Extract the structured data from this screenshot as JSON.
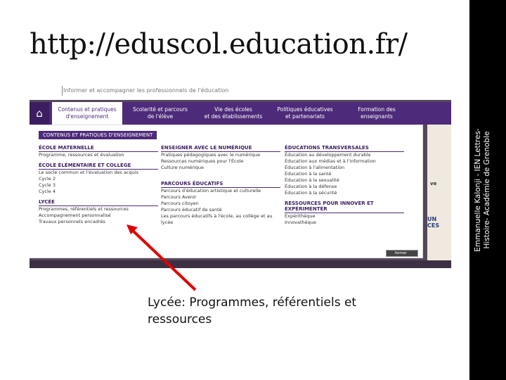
{
  "slide": {
    "title": "http://eduscol.education.fr/",
    "side_note_line1": "Emmanuelle Kalonji - IEN Lettres-",
    "side_note_line2": "Histoire- Académie de Grenoble",
    "caption_line1": "Lycée: Programmes, référentiels et",
    "caption_line2": "ressources"
  },
  "screenshot": {
    "top_text": "Informer et accompagner les professionnels de l'éducation",
    "nav": [
      {
        "label1": "Contenus et pratiques",
        "label2": "d'enseignement"
      },
      {
        "label1": "Scolarité et parcours",
        "label2": "de l'élève"
      },
      {
        "label1": "Vie des écoles",
        "label2": "et des établissements"
      },
      {
        "label1": "Politiques éducatives",
        "label2": "et partenariats"
      },
      {
        "label1": "Formation des",
        "label2": "enseignants"
      }
    ],
    "menu_head": "CONTENUS ET PRATIQUES D'ENSEIGNEMENT",
    "col1": {
      "sec1": "ÉCOLE MATERNELLE",
      "links1": [
        "Programme, ressources et évaluation"
      ],
      "sec2": "ÉCOLE ÉLÉMENTAIRE ET COLLÈGE",
      "links2": [
        "Le socle commun et l'évaluation des acquis",
        "Cycle 2",
        "Cycle 3",
        "Cycle 4"
      ],
      "sec3": "LYCÉE",
      "links3": [
        "Programmes, référentiels et ressources",
        "Accompagnement personnalisé",
        "Travaux personnels encadrés"
      ]
    },
    "col2": {
      "sec1": "ENSEIGNER AVEC LE NUMÉRIQUE",
      "links1": [
        "Pratiques pédagogiques avec le numérique",
        "Ressources numériques pour l'École",
        "Culture numérique"
      ],
      "sec2": "PARCOURS ÉDUCATIFS",
      "links2": [
        "Parcours d'éducation artistique et culturelle",
        "Parcours Avenir",
        "Parcours citoyen",
        "Parcours éducatif de santé",
        "Les parcours éducatifs à l'école, au collège et au",
        "lycée"
      ]
    },
    "col3": {
      "sec1": "ÉDUCATIONS TRANSVERSALES",
      "links1": [
        "Éducation au développement durable",
        "Éducation aux médias et à l'information",
        "Éducation à l'alimentation",
        "Éducation à la santé",
        "Éducation à la sexualité",
        "Éducation à la défense",
        "Éducation à la sécurité"
      ],
      "sec2": "RESSOURCES POUR INNOVER ET",
      "sec2b": "EXPÉRIMENTER",
      "links2": [
        "Expérithèque",
        "Innovathèque"
      ]
    },
    "search_label": "fermer",
    "right_text1": "ve",
    "right_text2_line1": "UN",
    "right_text2_line2": "CES"
  }
}
